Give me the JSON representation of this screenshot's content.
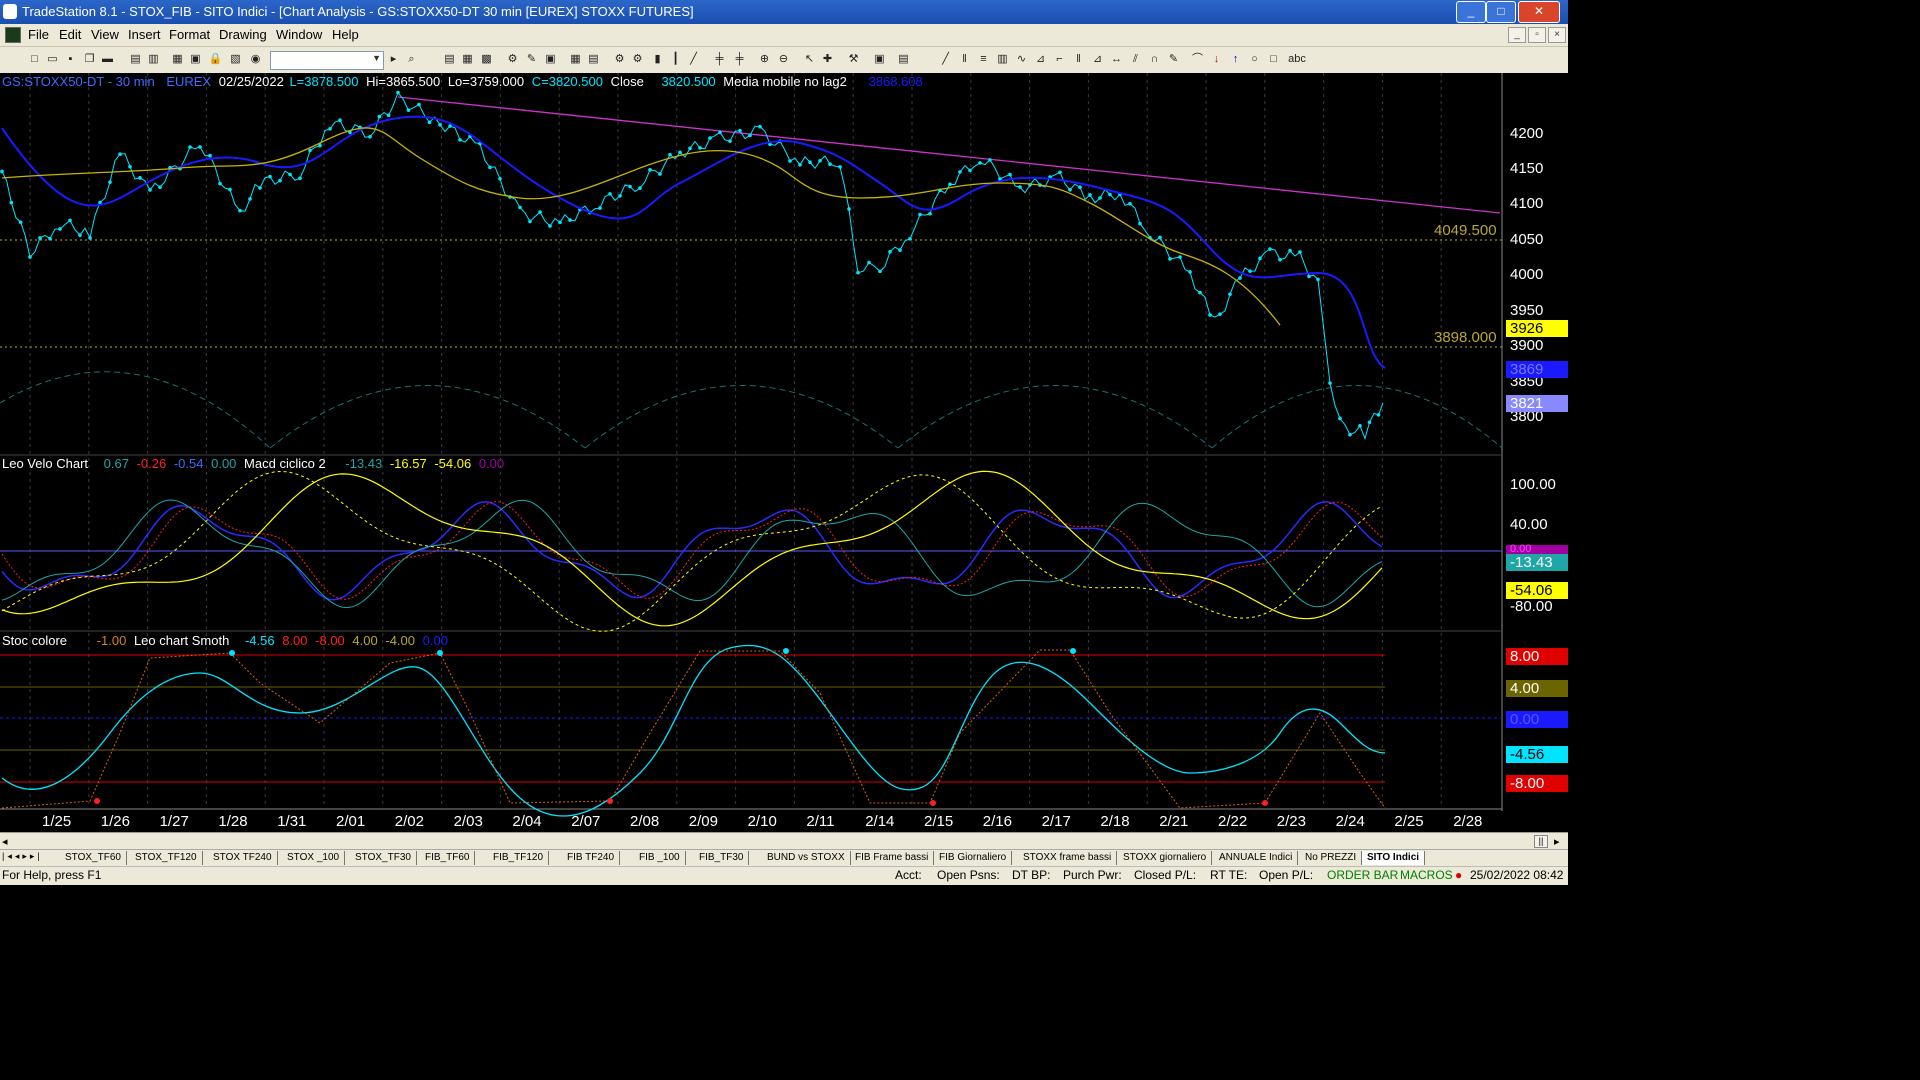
{
  "window": {
    "title": "TradeStation 8.1 - STOX_FIB - SITO Indici - [Chart Analysis - GS:STOXX50-DT  30 min  [EUREX] STOXX FUTURES]",
    "minimize": "_",
    "maximize": "□",
    "close": "✕"
  },
  "menu": {
    "items": [
      "File",
      "Edit",
      "View",
      "Insert",
      "Format",
      "Drawing",
      "Window",
      "Help"
    ]
  },
  "chart": {
    "header": {
      "symbol": "GS:STOXX50-DT - 30 min",
      "exchange": "EUREX",
      "date": "02/25/2022",
      "low_l": "L=3878.500",
      "hi": "Hi=3865.500",
      "lo": "Lo=3759.000",
      "close_c": "C=3820.500",
      "close_lbl": "Close",
      "close_val": "3820.500",
      "ma_lbl": "Media mobile no lag2",
      "ma_val": "3868.608"
    },
    "price_axis": [
      "4200",
      "4150",
      "4100",
      "4050",
      "4000",
      "3950",
      "3900",
      "3850",
      "3800"
    ],
    "levels": {
      "upper": "4049.500",
      "lower": "3898.000"
    },
    "price_boxes": {
      "yellow": "3926",
      "blue": "3869",
      "lavender": "3821"
    },
    "colors": {
      "price_dots": "#00e5ff",
      "ma_blue": "#1a1aff",
      "ma_yellow": "#c8b400",
      "trend": "#cc33cc",
      "cycle": "#1f6f6f"
    },
    "panel2": {
      "name": "Leo Velo Chart",
      "v1": "0.67",
      "v2": "-0.26",
      "v3": "-0.54",
      "v4": "0.00",
      "name2": "Macd ciclico 2",
      "w1": "-13.43",
      "w2": "-16.57",
      "w3": "-54.06",
      "w4": "0.00",
      "axis": [
        "100.00",
        "40.00",
        "-80.00"
      ],
      "boxes": {
        "purple": "0.00",
        "cyan": "-13.43",
        "yellow": "-54.06"
      }
    },
    "panel3": {
      "name": "Stoc colore",
      "v1": "-1.00",
      "name2": "Leo chart Smoth",
      "w1": "-4.56",
      "w2": "8.00",
      "w3": "-8.00",
      "w4": "4.00",
      "w5": "-4.00",
      "w6": "0.00",
      "boxes": {
        "red": "8.00",
        "olive": "4.00",
        "blue": "0.00",
        "cyan": "-4.56",
        "red2": "-8.00"
      }
    },
    "dates": [
      "1/25",
      "1/26",
      "1/27",
      "1/28",
      "1/31",
      "2/01",
      "2/02",
      "2/03",
      "2/04",
      "2/07",
      "2/08",
      "2/09",
      "2/10",
      "2/11",
      "2/14",
      "2/15",
      "2/16",
      "2/17",
      "2/18",
      "2/21",
      "2/22",
      "2/23",
      "2/24",
      "2/25",
      "2/28"
    ]
  },
  "tabs": [
    "STOX_TF60",
    "STOX_TF120",
    "STOX TF240",
    "STOX _100",
    "STOX_TF30",
    "FIB_TF60",
    "FIB_TF120",
    "FIB TF240",
    "FIB _100",
    "FIB_TF30",
    "BUND vs STOXX",
    "FIB Frame bassi",
    "FIB Giornaliero",
    "STOXX frame bassi",
    "STOXX giornaliero",
    "ANNUALE Indici",
    "No PREZZI",
    "SITO Indici"
  ],
  "status": {
    "help": "For Help, press F1",
    "acct": "Acct:",
    "open_psns": "Open Psns:",
    "dt_bp": "DT BP:",
    "purch_pwr": "Purch Pwr:",
    "closed_pl": "Closed P/L:",
    "rt_te": "RT TE:",
    "open_pl": "Open P/L:",
    "order_bar": "ORDER BAR",
    "macros": "MACROS",
    "datetime": "25/02/2022 08:42"
  }
}
